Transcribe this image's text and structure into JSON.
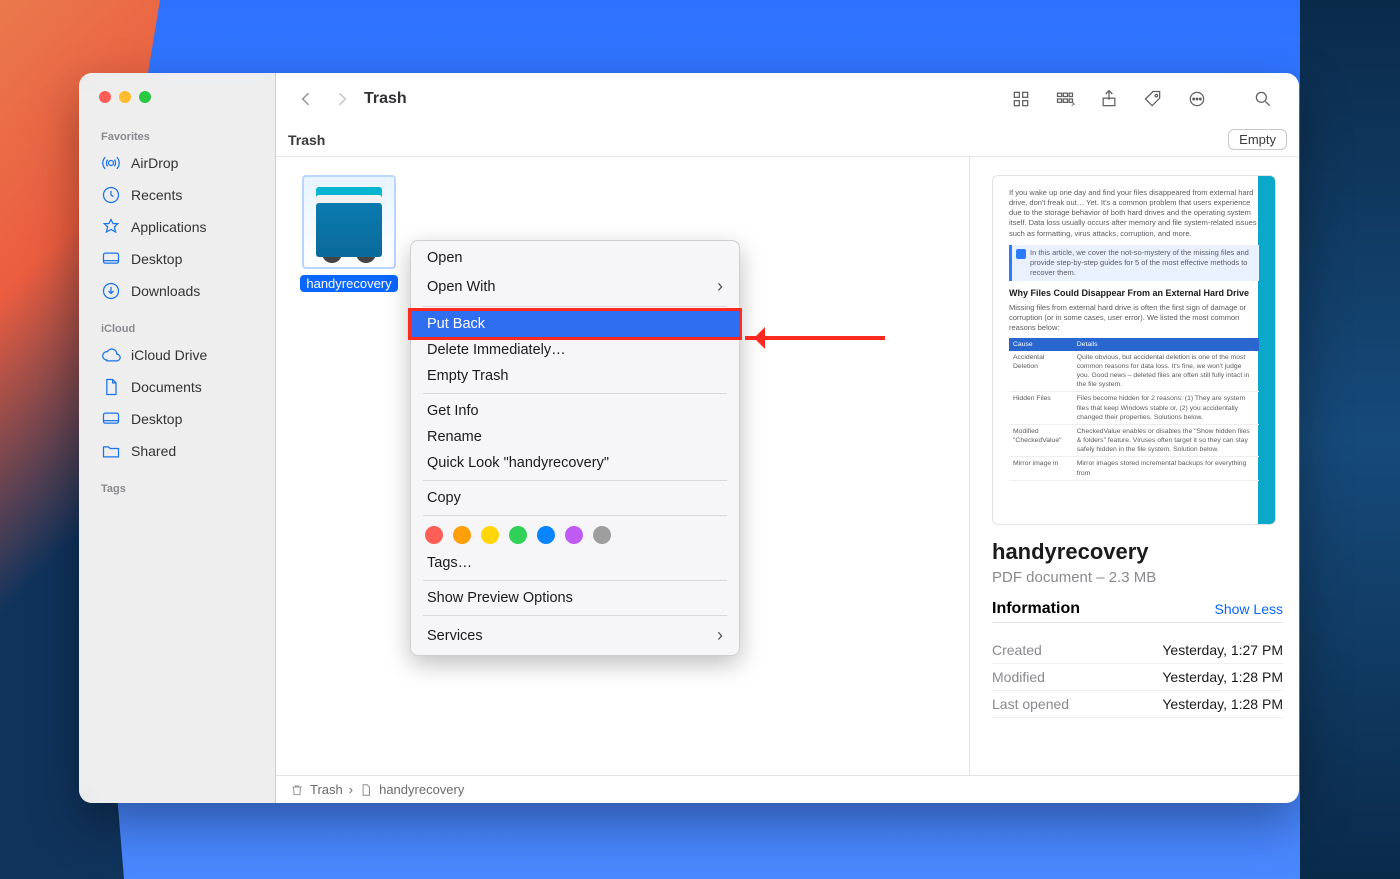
{
  "window": {
    "title": "Trash"
  },
  "sidebar": {
    "favorites_header": "Favorites",
    "icloud_header": "iCloud",
    "tags_header": "Tags",
    "favorites": [
      {
        "label": "AirDrop"
      },
      {
        "label": "Recents"
      },
      {
        "label": "Applications"
      },
      {
        "label": "Desktop"
      },
      {
        "label": "Downloads"
      }
    ],
    "icloud": [
      {
        "label": "iCloud Drive"
      },
      {
        "label": "Documents"
      },
      {
        "label": "Desktop"
      },
      {
        "label": "Shared"
      }
    ]
  },
  "subheader": {
    "title": "Trash",
    "empty_label": "Empty"
  },
  "file": {
    "name": "handyrecovery"
  },
  "context_menu": {
    "open": "Open",
    "open_with": "Open With",
    "put_back": "Put Back",
    "delete_immediately": "Delete Immediately…",
    "empty_trash": "Empty Trash",
    "get_info": "Get Info",
    "rename": "Rename",
    "quick_look": "Quick Look \"handyrecovery\"",
    "copy": "Copy",
    "tags": "Tags…",
    "show_preview": "Show Preview Options",
    "services": "Services"
  },
  "preview": {
    "name": "handyrecovery",
    "subtitle": "PDF document – 2.3 MB",
    "info_header": "Information",
    "show_less": "Show Less",
    "rows": [
      {
        "k": "Created",
        "v": "Yesterday, 1:27 PM"
      },
      {
        "k": "Modified",
        "v": "Yesterday, 1:28 PM"
      },
      {
        "k": "Last opened",
        "v": "Yesterday, 1:28 PM"
      }
    ],
    "doc": {
      "p1": "If you wake up one day and find your files disappeared from external hard drive, don't freak out… Yet. It's a common problem that users experience due to the storage behavior of both hard drives and the operating system itself. Data loss usually occurs after memory and file system-related issues such as formatting, virus attacks, corruption, and more.",
      "callout": "In this article, we cover the not-so-mystery of the missing files and provide step-by-step guides for 5 of the most effective methods to recover them.",
      "h": "Why Files Could Disappear From an External Hard Drive",
      "p2": "Missing files from external hard drive is often the first sign of damage or corruption (or in some cases, user error). We listed the most common reasons below:",
      "th1": "Cause",
      "th2": "Details",
      "r1k": "Accidental Deletion",
      "r1v": "Quite obvious, but accidental deletion is one of the most common reasons for data loss. It's fine, we won't judge you. Good news – deleted files are often still fully intact in the file system.",
      "r2k": "Hidden Files",
      "r2v": "Files become hidden for 2 reasons: (1) They are system files that keep Windows stable or, (2) you accidentally changed their properties. Solutions below.",
      "r3k": "Modified \"CheckedValue\"",
      "r3v": "CheckedValue enables or disables the \"Show hidden files & folders\" feature. Viruses often target it so they can stay safely hidden in the file system. Solution below.",
      "r4k": "Mirror image in",
      "r4v": "Mirror images stored incremental backups for everything from"
    }
  },
  "pathbar": {
    "root": "Trash",
    "leaf": "handyrecovery"
  }
}
